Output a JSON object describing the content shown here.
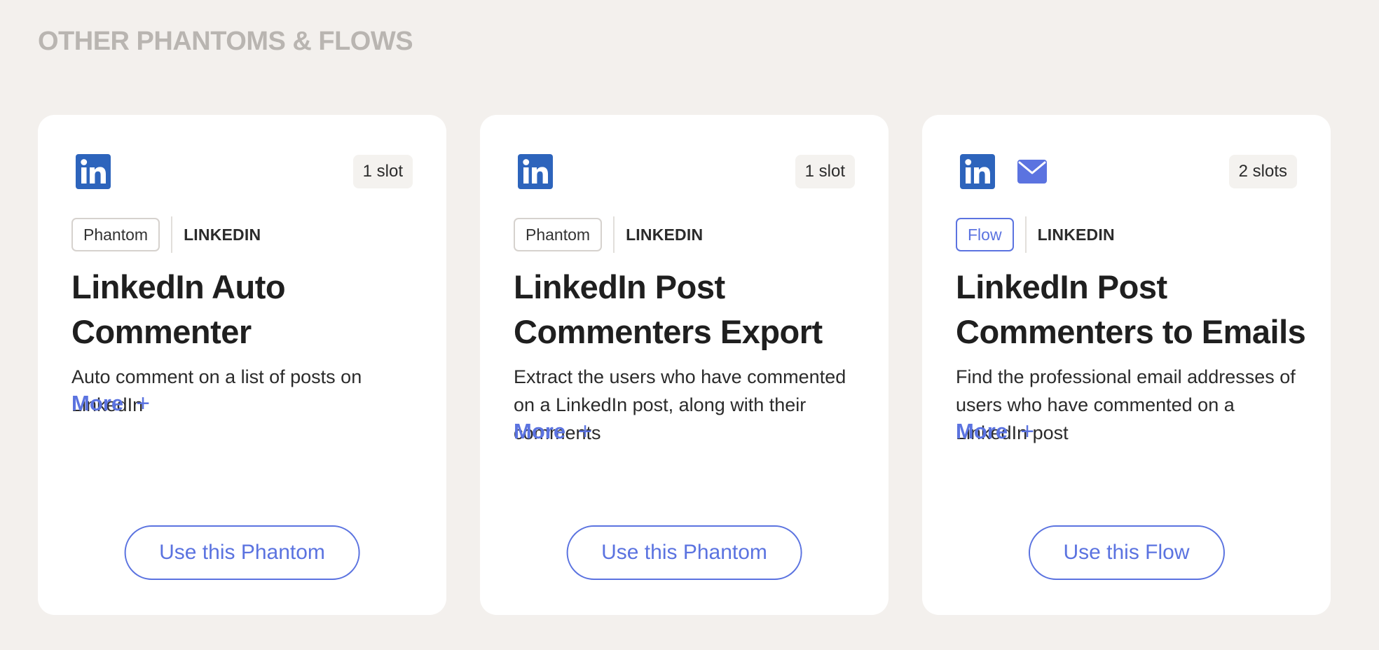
{
  "section": {
    "title": "OTHER PHANTOMS & FLOWS"
  },
  "colors": {
    "background": "#f3f0ed",
    "card": "#ffffff",
    "accent": "#5b73e0",
    "linkedin": "#2d64bc",
    "email_icon": "#5b73e0",
    "section_title": "#b9b5b1"
  },
  "cards": [
    {
      "icons": [
        "linkedin-icon"
      ],
      "slots": "1 slot",
      "type": "Phantom",
      "platform": "LINKEDIN",
      "title": "LinkedIn Auto Commenter",
      "description": "Auto comment on a list of posts on LinkedIn",
      "more_label": "More",
      "more_icon": "plus-icon",
      "cta": "Use this Phantom"
    },
    {
      "icons": [
        "linkedin-icon"
      ],
      "slots": "1 slot",
      "type": "Phantom",
      "platform": "LINKEDIN",
      "title": "LinkedIn Post Commenters Export",
      "description": "Extract the users who have commented on a LinkedIn post, along with their comments",
      "more_label": "More",
      "more_icon": "plus-icon",
      "cta": "Use this Phantom"
    },
    {
      "icons": [
        "linkedin-icon",
        "email-icon"
      ],
      "slots": "2 slots",
      "type": "Flow",
      "platform": "LINKEDIN",
      "title": "LinkedIn Post Commenters to Emails",
      "description": "Find the professional email addresses of users who have commented on a LinkedIn post",
      "more_label": "More",
      "more_icon": "plus-icon",
      "cta": "Use this Flow"
    }
  ]
}
